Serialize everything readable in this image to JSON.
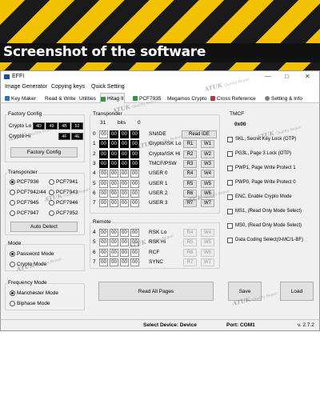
{
  "banner": {
    "title": "Screenshot of the software"
  },
  "window": {
    "title": "EFFI",
    "controls": [
      "—",
      "□",
      "✕"
    ]
  },
  "menu": [
    "Image Generator",
    "Copying keys",
    "Quick Setting"
  ],
  "tabs": [
    {
      "label": "Key Maker",
      "active": false
    },
    {
      "label": "Read & Write",
      "active": false
    },
    {
      "label": "Utilities",
      "active": false
    },
    {
      "label": "Hitag II",
      "active": true
    },
    {
      "label": "PCF7935",
      "active": false
    },
    {
      "label": "Megamos Crypto",
      "active": false
    },
    {
      "label": "Cross Reference",
      "active": false
    },
    {
      "label": "Setting & Info",
      "active": false
    }
  ],
  "factory_config": {
    "label": "Factory Config",
    "crypto_lo_label": "Crypto Lo",
    "crypto_hi_label": "Crypto Hi",
    "crypto_lo_bytes": [
      "4D",
      "49",
      "4B",
      "52"
    ],
    "crypto_hi_bytes": [
      "4F",
      "4E"
    ],
    "button": "Factory Config"
  },
  "transponder": {
    "label": "Transponder",
    "options": [
      "PCF7936",
      "PCF7941",
      "PCF7942/44",
      "PCF7943",
      "PCF7945",
      "PCF7946",
      "PCF7947",
      "PCF7952"
    ],
    "selected": "PCF7936",
    "button": "Auto Detect"
  },
  "mode": {
    "label": "Mode",
    "options": [
      "Password Mode",
      "Crypto Mode"
    ],
    "selected": "Password Mode"
  },
  "frequency_mode": {
    "label": "Frequency Mode",
    "options": [
      "Manchester Mode",
      "Biphase Mode"
    ],
    "selected": "Manchester Mode"
  },
  "transponder_panel": {
    "label": "Transponder",
    "bits_value": "31",
    "bits_label": "bits",
    "zero_value": "0",
    "read_ide": "Read IDE",
    "rows": [
      {
        "page": "0",
        "bytes": [
          "00",
          "00",
          "00",
          "00"
        ],
        "name": "SN/IDE",
        "r": "",
        "w": ""
      },
      {
        "page": "1",
        "bytes": [
          "00",
          "00",
          "00",
          "00"
        ],
        "name": "Crypto/ISK Lo",
        "r": "R1",
        "w": "W1"
      },
      {
        "page": "2",
        "bytes": [
          "00",
          "00",
          "00",
          "00"
        ],
        "name": "Crypto/ISK Hi",
        "r": "R2",
        "w": "W2"
      },
      {
        "page": "3",
        "bytes": [
          "00",
          "00",
          "00",
          "00"
        ],
        "name": "TMCF/PSW",
        "r": "R3",
        "w": "W3"
      },
      {
        "page": "4",
        "bytes": [
          "00",
          "00",
          "00",
          "00"
        ],
        "name": "USER 0",
        "r": "R4",
        "w": "W4"
      },
      {
        "page": "5",
        "bytes": [
          "00",
          "00",
          "00",
          "00"
        ],
        "name": "USER 1",
        "r": "R5",
        "w": "W5"
      },
      {
        "page": "6",
        "bytes": [
          "00",
          "00",
          "00",
          "00"
        ],
        "name": "USER 2",
        "r": "R6",
        "w": "W6"
      },
      {
        "page": "7",
        "bytes": [
          "00",
          "00",
          "00",
          "00"
        ],
        "name": "USER 3",
        "r": "R7",
        "w": "W7"
      }
    ]
  },
  "remote": {
    "label": "Remote",
    "rows": [
      {
        "page": "4",
        "bytes": [
          "00",
          "00",
          "00",
          "00"
        ],
        "name": "RSK Lo",
        "r": "R4",
        "w": "W4"
      },
      {
        "page": "5",
        "bytes": [
          "00",
          "00",
          "00",
          "00"
        ],
        "name": "RSK Hi",
        "r": "R5",
        "w": "W5"
      },
      {
        "page": "6",
        "bytes": [
          "00",
          "00",
          "00",
          "00"
        ],
        "name": "RCF",
        "r": "R6",
        "w": "W6"
      },
      {
        "page": "7",
        "bytes": [
          "00",
          "00",
          "00",
          "00"
        ],
        "name": "SYNC",
        "r": "R7",
        "w": "W7"
      }
    ]
  },
  "tmcf": {
    "label": "TMCF",
    "value": "0x00",
    "options": [
      "SKL, Secret Key Lock (OTP)",
      "PG3L, Page 3 Lock (OTP)",
      "PWP1, Page Write Protect 1",
      "PWP0, Page Write Protect 0",
      "ENC, Enable Crypto Mode",
      "MS1, (Read Only Mode Select)",
      "MS0, (Read Only Mode Select)",
      "Data Coding Select(0-MC/1-BF)"
    ]
  },
  "actions": {
    "read_all": "Read All Pages",
    "save": "Save",
    "load": "Load"
  },
  "status": {
    "device": "Select Device: Device",
    "port": "Port: COM1",
    "version": "v. 2.7.2"
  },
  "watermark": {
    "brand": "ATUK",
    "tag": "Quality Repair"
  },
  "colors": {
    "banner_yellow": "#f2c100",
    "banner_dark": "#111111",
    "window_bg": "#f0f0f0"
  }
}
